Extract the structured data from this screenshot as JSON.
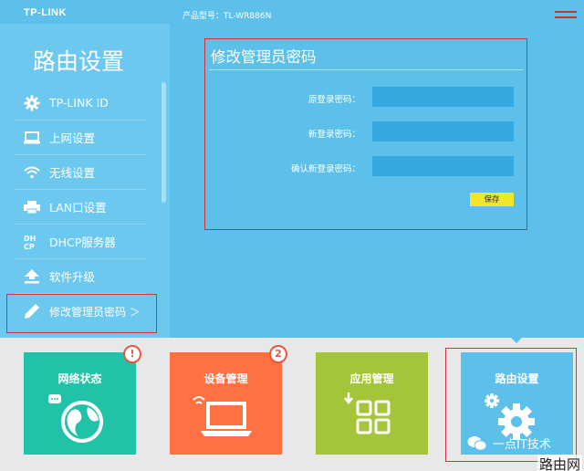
{
  "header": {
    "logo": "TP-LINK",
    "model": "产品型号：TL-WR886N"
  },
  "sidebar": {
    "title": "路由设置",
    "items": [
      {
        "label": "TP-LINK ID",
        "icon": "gear-icon"
      },
      {
        "label": "上网设置",
        "icon": "monitor-icon"
      },
      {
        "label": "无线设置",
        "icon": "wifi-icon"
      },
      {
        "label": "LAN口设置",
        "icon": "printer-icon"
      },
      {
        "label": "DHCP服务器",
        "icon": "dhcp-icon"
      },
      {
        "label": "软件升级",
        "icon": "upload-icon"
      },
      {
        "label": "修改管理员密码 ＞",
        "icon": "pencil-icon"
      }
    ]
  },
  "panel": {
    "title": "修改管理员密码",
    "fields": [
      {
        "label": "原登录密码：",
        "value": ""
      },
      {
        "label": "新登录密码：",
        "value": ""
      },
      {
        "label": "确认新登录密码：",
        "value": ""
      }
    ],
    "save_label": "保存"
  },
  "tiles": [
    {
      "label": "网络状态",
      "badge": "!",
      "color": "#20c3a8",
      "icon": "globe-icon"
    },
    {
      "label": "设备管理",
      "badge": "2",
      "color": "#ff7043",
      "icon": "laptop-icon"
    },
    {
      "label": "应用管理",
      "badge": "",
      "color": "#a4c439",
      "icon": "apps-icon"
    },
    {
      "label": "路由设置",
      "badge": "",
      "color": "#5cc0ea",
      "icon": "settings-gear-icon"
    }
  ],
  "watermark": {
    "text": "一点IT技术",
    "site": "路由网"
  }
}
